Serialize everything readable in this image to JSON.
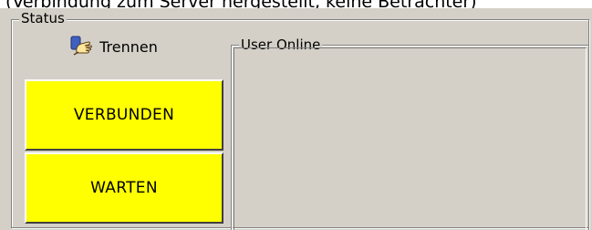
{
  "caption": "(Verbindung zum Server hergestellt, keine Betrachter)",
  "status_group": {
    "title": "Status",
    "disconnect_button": {
      "label": "Trennen",
      "icon": "hand-icon"
    },
    "connection_state": {
      "label": "VERBUNDEN",
      "color": "#ffff00"
    },
    "wait_state": {
      "label": "WARTEN",
      "color": "#ffff00"
    }
  },
  "user_online_group": {
    "title": "User Online",
    "users": []
  }
}
